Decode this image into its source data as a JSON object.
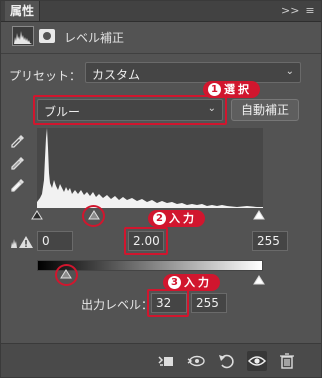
{
  "header": {
    "title": "属性",
    "expand_label": ">>",
    "menu_label": "≡"
  },
  "adjustment": {
    "name": "レベル補正",
    "adj_icon": "levels-histogram-icon",
    "mask_icon": "layer-mask-icon"
  },
  "preset": {
    "label": "プリセット：",
    "value": "カスタム"
  },
  "channel": {
    "value": "ブルー",
    "auto_button": "自動補正"
  },
  "eyedroppers": [
    "black-point-eyedropper-icon",
    "gray-point-eyedropper-icon",
    "white-point-eyedropper-icon"
  ],
  "input_levels": {
    "shadow": "0",
    "midtone": "2.00",
    "highlight": "255"
  },
  "output_levels": {
    "label": "出力レベル：",
    "shadow": "32",
    "highlight": "255"
  },
  "callouts": [
    {
      "number": "1",
      "text": "選択"
    },
    {
      "number": "2",
      "text": "入力"
    },
    {
      "number": "3",
      "text": "入力"
    }
  ],
  "bottom_bar": [
    "clip-to-layer-icon",
    "view-previous-state-icon",
    "reset-icon",
    "visibility-eye-icon",
    "delete-trash-icon"
  ],
  "colors": {
    "panel_bg": "#535353",
    "accent_red": "#d1162e",
    "histogram_bg": "#474747"
  }
}
